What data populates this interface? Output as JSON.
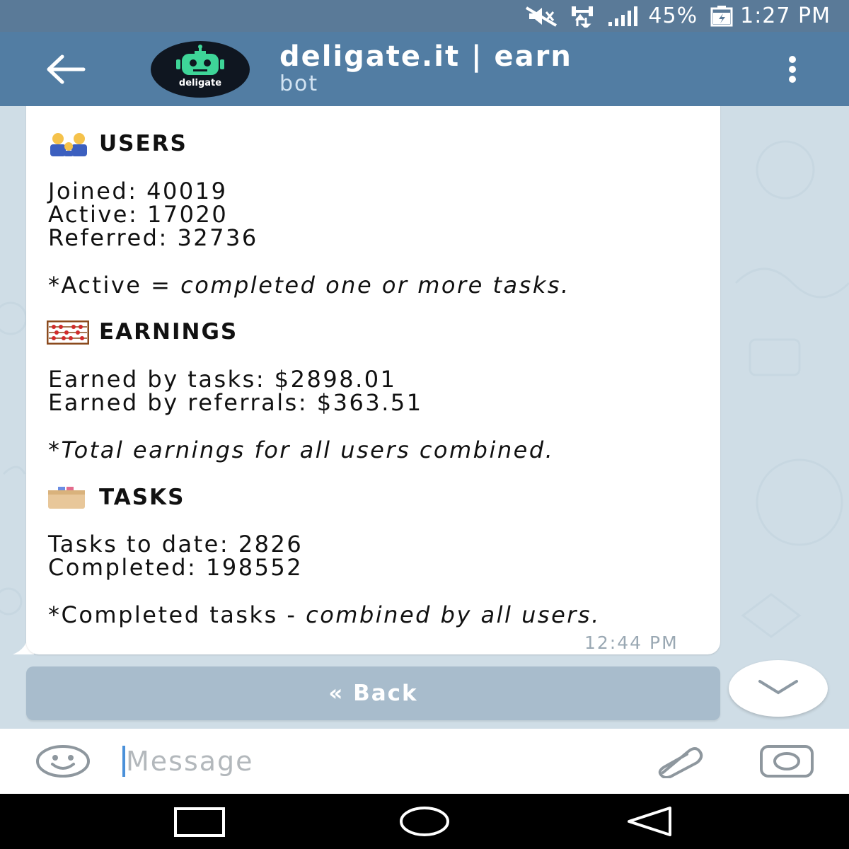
{
  "status_bar": {
    "battery": "45%",
    "time": "1:27 PM"
  },
  "header": {
    "title": "deligate.it | earn",
    "subtitle": "bot",
    "avatar_label": "deligate"
  },
  "message": {
    "users_heading": "USERS",
    "joined": "Joined: 40019",
    "active": "Active: 17020",
    "referred": "Referred: 32736",
    "active_note_prefix": "*Active = ",
    "active_note_italic": "completed one or more tasks.",
    "earnings_heading": "EARNINGS",
    "earned_tasks": "Earned by tasks: $2898.01",
    "earned_referrals": "Earned by referrals: $363.51",
    "earnings_note": "*Total earnings for all users combined.",
    "tasks_heading": "TASKS",
    "tasks_to_date": "Tasks to date: 2826",
    "completed": "Completed: 198552",
    "completed_note_prefix": "*Completed tasks - ",
    "completed_note_italic": "combined by all users.",
    "timestamp": "12:44 PM"
  },
  "keyboard": {
    "back_label": "« Back"
  },
  "input": {
    "placeholder": "Message"
  },
  "colors": {
    "status_bar": "#5a7a98",
    "header": "#527da3",
    "chat_background": "#cfdde6",
    "keyboard_button": "#a8bccc"
  },
  "icons": {
    "status": [
      "mute-icon",
      "data-transfer-icon",
      "signal-icon",
      "battery-charging-icon"
    ],
    "header": [
      "back-arrow-icon",
      "more-vert-icon"
    ],
    "input": [
      "emoji-icon",
      "attach-icon",
      "camera-icon"
    ],
    "nav": [
      "recent-apps-icon",
      "home-icon",
      "back-nav-icon"
    ]
  }
}
